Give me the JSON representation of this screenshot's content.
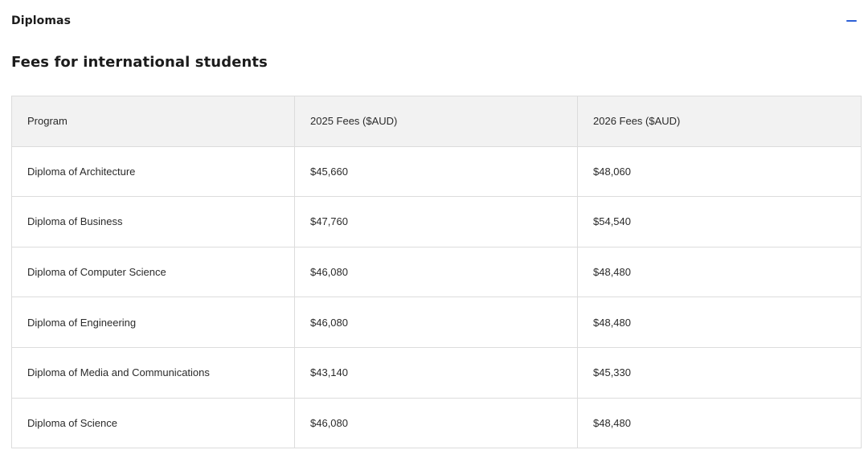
{
  "accordion": {
    "title": "Diplomas",
    "toggle_icon": "minus-icon",
    "toggle_color": "#2c5fd6"
  },
  "section": {
    "heading": "Fees for international students"
  },
  "table": {
    "headers": [
      "Program",
      "2025 Fees ($AUD)",
      "2026 Fees ($AUD)"
    ],
    "rows": [
      [
        "Diploma of Architecture",
        "$45,660",
        "$48,060"
      ],
      [
        "Diploma of Business",
        "$47,760",
        "$54,540"
      ],
      [
        "Diploma of Computer Science",
        "$46,080",
        "$48,480"
      ],
      [
        "Diploma of Engineering",
        "$46,080",
        "$48,480"
      ],
      [
        "Diploma of Media and Communications",
        "$43,140",
        "$45,330"
      ],
      [
        "Diploma of Science",
        "$46,080",
        "$48,480"
      ]
    ]
  }
}
